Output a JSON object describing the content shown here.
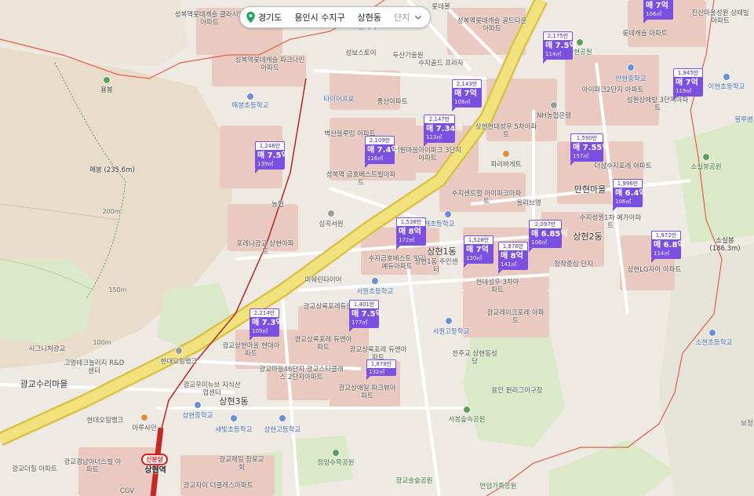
{
  "location_bar": {
    "province": "경기도",
    "city": "용인시 수지구",
    "dong": "상현동",
    "mode": "단지"
  },
  "areas": [
    {
      "name": "광교수리마을"
    },
    {
      "name": "상현3동"
    },
    {
      "name": "상현2동"
    },
    {
      "name": "만현마을"
    },
    {
      "name": "상현1동"
    }
  ],
  "labels": [
    "성복역롯데캐슬 클라시엘아파트",
    "성복역롯데캐슬 골드타운아파트",
    "성복역롯데캐슬 파크나인아파트",
    "롯데몰",
    "성복역",
    "수지골드 프라자",
    "두산기술원",
    "성보스토어",
    "풍산아파트",
    "타이어프로",
    "매봉초등학교",
    "벽산블루밍 아파트",
    "성복역 금호베스트빌아파트",
    "서원마을아이파크 3단지아파트",
    "상현현대성우 5차아파트",
    "NH농협은행",
    "파리바게트",
    "수지센트럴 아이파크아파트",
    "올리브영",
    "솔개초등학교",
    "심곡서원",
    "농협",
    "포레나광교 상현아파트",
    "미쉐린타이어",
    "수지금호베스트 빌리예듀아파트",
    "상현1동 주민센터",
    "서원초등학교",
    "광교상록포레듀엔",
    "광교상현마을 현대아파트",
    "현대오일뱅크",
    "광교우미뉴브 지식산업센터",
    "광교마을46단지 광교스타클래스 2단지아파트",
    "광교상록포레 듀엔아파트",
    "광교상록포레 듀엔아파트",
    "서원고등학교",
    "천주교 상현동성당",
    "용인 원리그이구장",
    "광교상애일 파크뷰아파트",
    "광교레이크포레 아파트",
    "현대성우 3차아파트",
    "장작중심 단지",
    "더샵수지포레 아파트",
    "수지성원1차 예가아파트",
    "상현LG자이 아파트",
    "소현초등학교",
    "이현초등학교",
    "만현중학교",
    "아이파크2단지 아파트",
    "성원상떼빌 3단지아파트",
    "진산마을성원 상떼빌아파트",
    "롯데캐슬 아파트",
    "만현공원",
    "소실봉공원",
    "소실봉 (186.3m)",
    "매봉 (235.6m)",
    "용봉",
    "시그니처광교",
    "고영테크놀러지 R&D센터",
    "현대오일뱅크",
    "마루사던",
    "광교경남아너스빌 아파트",
    "광교더힐 아파트",
    "광교제일 장로교회",
    "광교자이 더클래스아파트",
    "상현중학교",
    "새빛초등학교",
    "상현고등학교",
    "정암수목공원",
    "광교솔숲공원",
    "서봉숲속공원",
    "번암가족공원",
    "보정",
    "불루벤",
    "200m",
    "150m",
    "100m",
    "CGV",
    "현대고 상현동"
  ],
  "station": {
    "line": "신분당",
    "name": "상현역"
  },
  "markers": [
    {
      "ppm": "1,246만",
      "price": "매 7.5억",
      "area": "139㎡"
    },
    {
      "ppm": "2,109만",
      "price": "매 7.4억",
      "area": "116㎡"
    },
    {
      "ppm": "2,147만",
      "price": "매 7.34억",
      "area": "113㎡"
    },
    {
      "ppm": "2,143만",
      "price": "매 7억",
      "area": "108㎡"
    },
    {
      "ppm": "2,175만",
      "price": "매 7.5억",
      "area": "114㎡"
    },
    {
      "ppm": "",
      "price": "매 7억",
      "area": "106㎡"
    },
    {
      "ppm": "1,945만",
      "price": "매 7억",
      "area": "119㎡"
    },
    {
      "ppm": "1,590만",
      "price": "매 7.55억",
      "area": "157㎡"
    },
    {
      "ppm": "1,996만",
      "price": "매 6.4억",
      "area": "106㎡"
    },
    {
      "ppm": "1,538만",
      "price": "매 8억",
      "area": "172㎡"
    },
    {
      "ppm": "1,528만",
      "price": "매 7억",
      "area": "120㎡"
    },
    {
      "ppm": "1,876만",
      "price": "매 8억",
      "area": "141㎡"
    },
    {
      "ppm": "2,097만",
      "price": "매 6.85억",
      "area": "108㎡"
    },
    {
      "ppm": "1,972만",
      "price": "매 6.8억",
      "area": "114㎡"
    },
    {
      "ppm": "2,214만",
      "price": "매 7.3억",
      "area": "109㎡"
    },
    {
      "ppm": "1,401만",
      "price": "매 7.5억",
      "area": "177㎡"
    },
    {
      "ppm": "1,878만",
      "price": "",
      "area": "132㎡"
    }
  ],
  "colors": {
    "marker": "#7b4fe0",
    "boundary": "#e0604a",
    "road": "#e9d96b",
    "apartment": "#eac9c0",
    "mountain": "#e8d9c6"
  }
}
